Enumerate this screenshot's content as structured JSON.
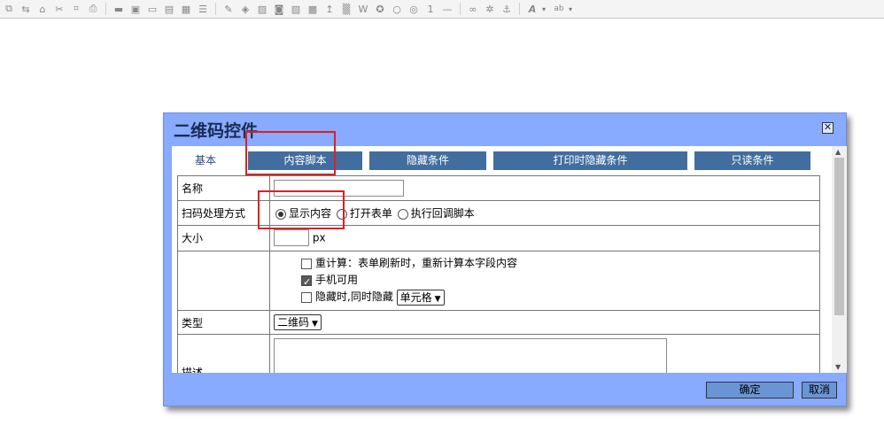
{
  "toolbar": {
    "icons": [
      "copy-icon",
      "share-icon",
      "house-icon",
      "link-icon",
      "frame-icon",
      "print-icon",
      "line-icon",
      "save-icon",
      "page-icon",
      "archive-icon",
      "document-icon",
      "list-icon",
      "pencil-icon",
      "layers-icon",
      "image-icon",
      "camera-icon",
      "chart-icon",
      "map-icon",
      "pin-icon",
      "qrcode-icon",
      "word-icon",
      "stamp-icon",
      "circle-icon",
      "record-icon",
      "number-icon",
      "hr-icon",
      "chain-link-icon",
      "settings-icon",
      "anchor-icon",
      "font-color-icon",
      "highlight-icon"
    ],
    "font_label": "A",
    "highlight_label": "ab"
  },
  "dialog": {
    "title": "二维码控件",
    "close_glyph": "✕",
    "tabs": [
      "基本",
      "内容脚本",
      "隐藏条件",
      "打印时隐藏条件",
      "只读条件"
    ],
    "active_tab": "基本",
    "fields": {
      "name_label": "名称",
      "name_value": "",
      "scan_label": "扫码处理方式",
      "scan_options": [
        "显示内容",
        "打开表单",
        "执行回调脚本"
      ],
      "scan_selected": "显示内容",
      "size_label": "大小",
      "size_value": "",
      "size_unit": "px",
      "recalc_label": "重计算：表单刷新时，重新计算本字段内容",
      "recalc_checked": false,
      "mobile_label": "手机可用",
      "mobile_checked": true,
      "hide_label": "隐藏时,同时隐藏",
      "hide_checked": false,
      "hide_select": "单元格",
      "type_label": "类型",
      "type_select": "二维码",
      "desc_label": "描述",
      "desc_value": ""
    },
    "ok_label": "确定",
    "cancel_label": "取消"
  },
  "colors": {
    "dialog_bg": "#88aaff",
    "tab_bg": "#426e9f",
    "annotation": "#e02020",
    "button_bg": "#6a95d5"
  }
}
